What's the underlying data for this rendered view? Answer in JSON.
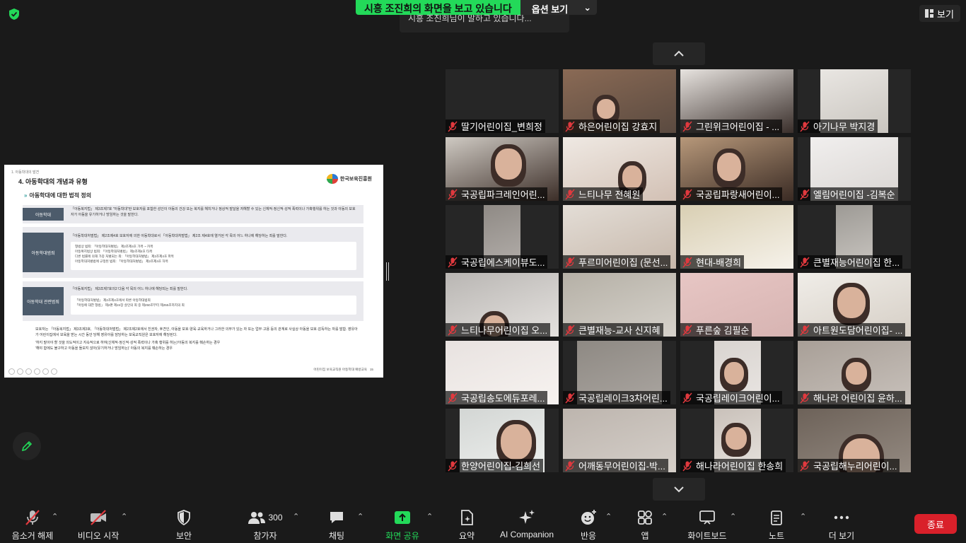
{
  "banner": {
    "sharing_text": "시흥 조진희의 화면을 보고 있습니다",
    "options_label": "옵션 보기"
  },
  "speaking": {
    "text": "시흥 조진희님이 말하고 있습니다..."
  },
  "view_button": {
    "label": "보기"
  },
  "slide": {
    "crumb": "1. 아동학대의 발견",
    "title": "4. 아동학대의 개념과 유형",
    "logo": "한국보육진흥원",
    "subtitle": "아동학대에 대한 법적 정의",
    "row1_tag": "아동학대",
    "row1_text": "「아동복지법」 제3조제7호 \"아동학대\"란 보호자를 포함한 성인이 아동의 건강 또는 복지를 해치거나 정상적 발달을 저해할 수 있는 신체적·정신적·성적 폭력이나 가혹행위를 하는 것과 아동의 보호자가 아동을 유기하거나 방임하는 것을 말한다.",
    "row2_tag": "아동학대범죄",
    "row2_text": "「아동학대처벌법」 제2조제4호 보호자에 의한 아동학대로서 「아동학대처벌법」 제2조 제4호에 열거된 각 목의 어느 하나에 해당하는 죄를 말한다.",
    "row2_items": [
      "형법상 범죄: 「아동학대처벌법」 제2조제4호 가목 ~ 카목",
      "아동복지법상 범죄: 「아동학대처벌법」 제2조제4호 타목",
      "다른 법률에 의해 가중 처벌되는 죄: 「아동학대처벌법」 제2조제4호 파목",
      "아동학대처벌법에 규정된 범죄: 「아동학대처벌법」 제2조제4호 하목"
    ],
    "row3_tag": "아동학대 관련범죄",
    "row3_text": "「아동복지법」 제3조제7호의2 다음 각 목의 어느 하나에 해당되는 죄를 말한다.",
    "row3_items": [
      "「아동학대처벌법」 제2조제4호에서 따른 아동학대범죄",
      "「아동에 대한 형법」 제2편 제24장 살인의 죄 중 제250조부터 제255조까지의 죄"
    ],
    "note1": "보호자는 「아동복지법」 제3조제3호, 「아동학대처벌법」 제2조제2호에서 친권자, 후견인, 아동을 보호·양육·교육하거나 그러한 의무가 있는 자 또는 업무·고용 등의 관계로 사실상 아동을 보호·감독하는 자를 말함. 영유아가 어린이집에서 보육을 받는 시간 동안 당해 영유아를 담당하는 보육교직원은 보호자에 해당된다.",
    "note2": "'하지 말아야 할 것을 의도적이고 지속적으로 하여(신체적·정신적·성적 폭력이나 가혹 행위를 하는)'아동의 복지를 훼손하는 경우",
    "note3": "'해야 함에도 불구하고 아동을 돌보지 않아(유기하거나 방임하는)' 아동의 복지를 훼손하는 경우",
    "page_info": "어린이집 보육교직원 아동학대 예방교육",
    "page_no": "15"
  },
  "participants": [
    "딸기어린이집_변희정",
    "하은어린이집 강효지",
    "그린위크어린이집 - ...",
    "아기나무 박지경",
    "국공립파크레인어린...",
    "느티나무 전혜원",
    "국공립파랑새어린이...",
    "엘림어린이집 -김복순",
    "국공립에스케이뷰도...",
    "푸르미어린이집 (문선...",
    "현대-배경희",
    "큰별재능어린이집 한...",
    "느티나무어린이집 오...",
    "큰별재능-교사 신지혜",
    "푸른숲 김필순",
    "아트원도담어린이집- ...",
    "국공립송도에듀포레...",
    "국공립레이크3차어린...",
    "국공립레이크어린이...",
    "해나라 어린이집 윤하...",
    "한양어린이집-김희선",
    "어깨동무어린이집-박...",
    "해나라어린이집 한송희",
    "국공립해누리어린이..."
  ],
  "toolbar": {
    "unmute": "음소거 해제",
    "start_video": "비디오 시작",
    "security": "보안",
    "participants": "참가자",
    "participants_count": "300",
    "chat": "채팅",
    "share_screen": "화면 공유",
    "summary": "요약",
    "ai_companion": "AI Companion",
    "reactions": "반응",
    "apps": "앱",
    "whiteboard": "화이트보드",
    "notes": "노트",
    "more": "더 보기",
    "end": "종료"
  },
  "colors": {
    "share_green": "#23d959",
    "end_red": "#d9202a",
    "muted_red": "#e0393e"
  }
}
